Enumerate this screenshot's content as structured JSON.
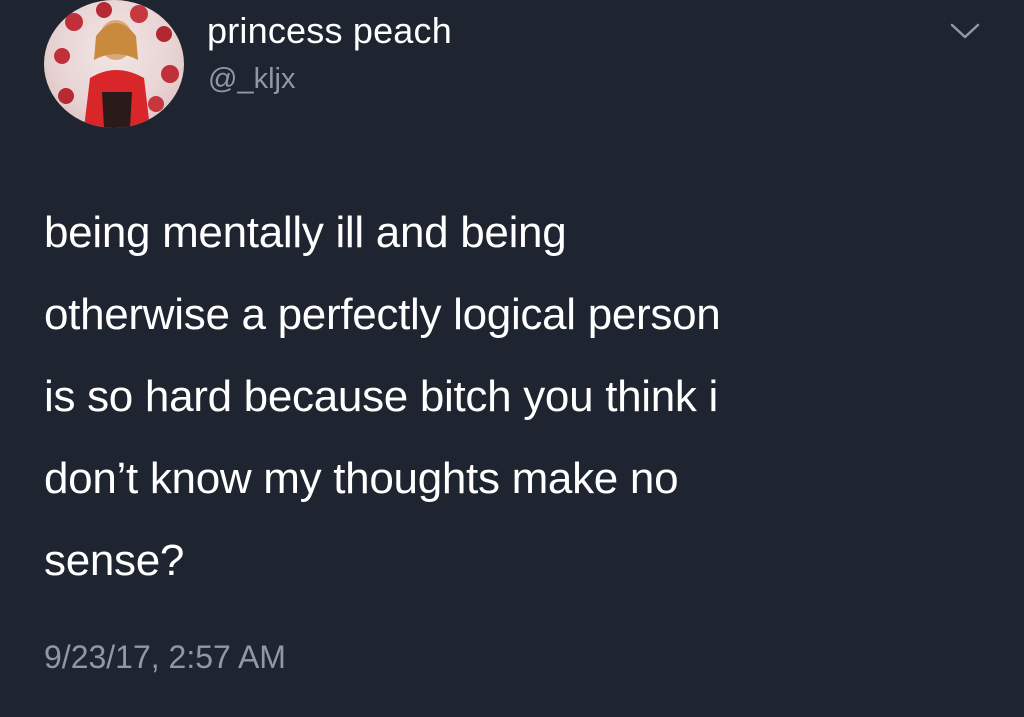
{
  "user": {
    "display_name": "princess peach",
    "handle": "@_kljx",
    "avatar_icon": "profile-photo"
  },
  "menu": {
    "icon": "chevron-down-icon"
  },
  "tweet": {
    "lines": [
      "being mentally ill and being",
      "otherwise a perfectly logical person",
      "is so hard because bitch you think i",
      "don’t know my thoughts make no",
      "sense?"
    ],
    "timestamp": "9/23/17, 2:57 AM"
  },
  "colors": {
    "background": "#1e2530",
    "text": "#ffffff",
    "secondary_text": "#8e99a6"
  }
}
